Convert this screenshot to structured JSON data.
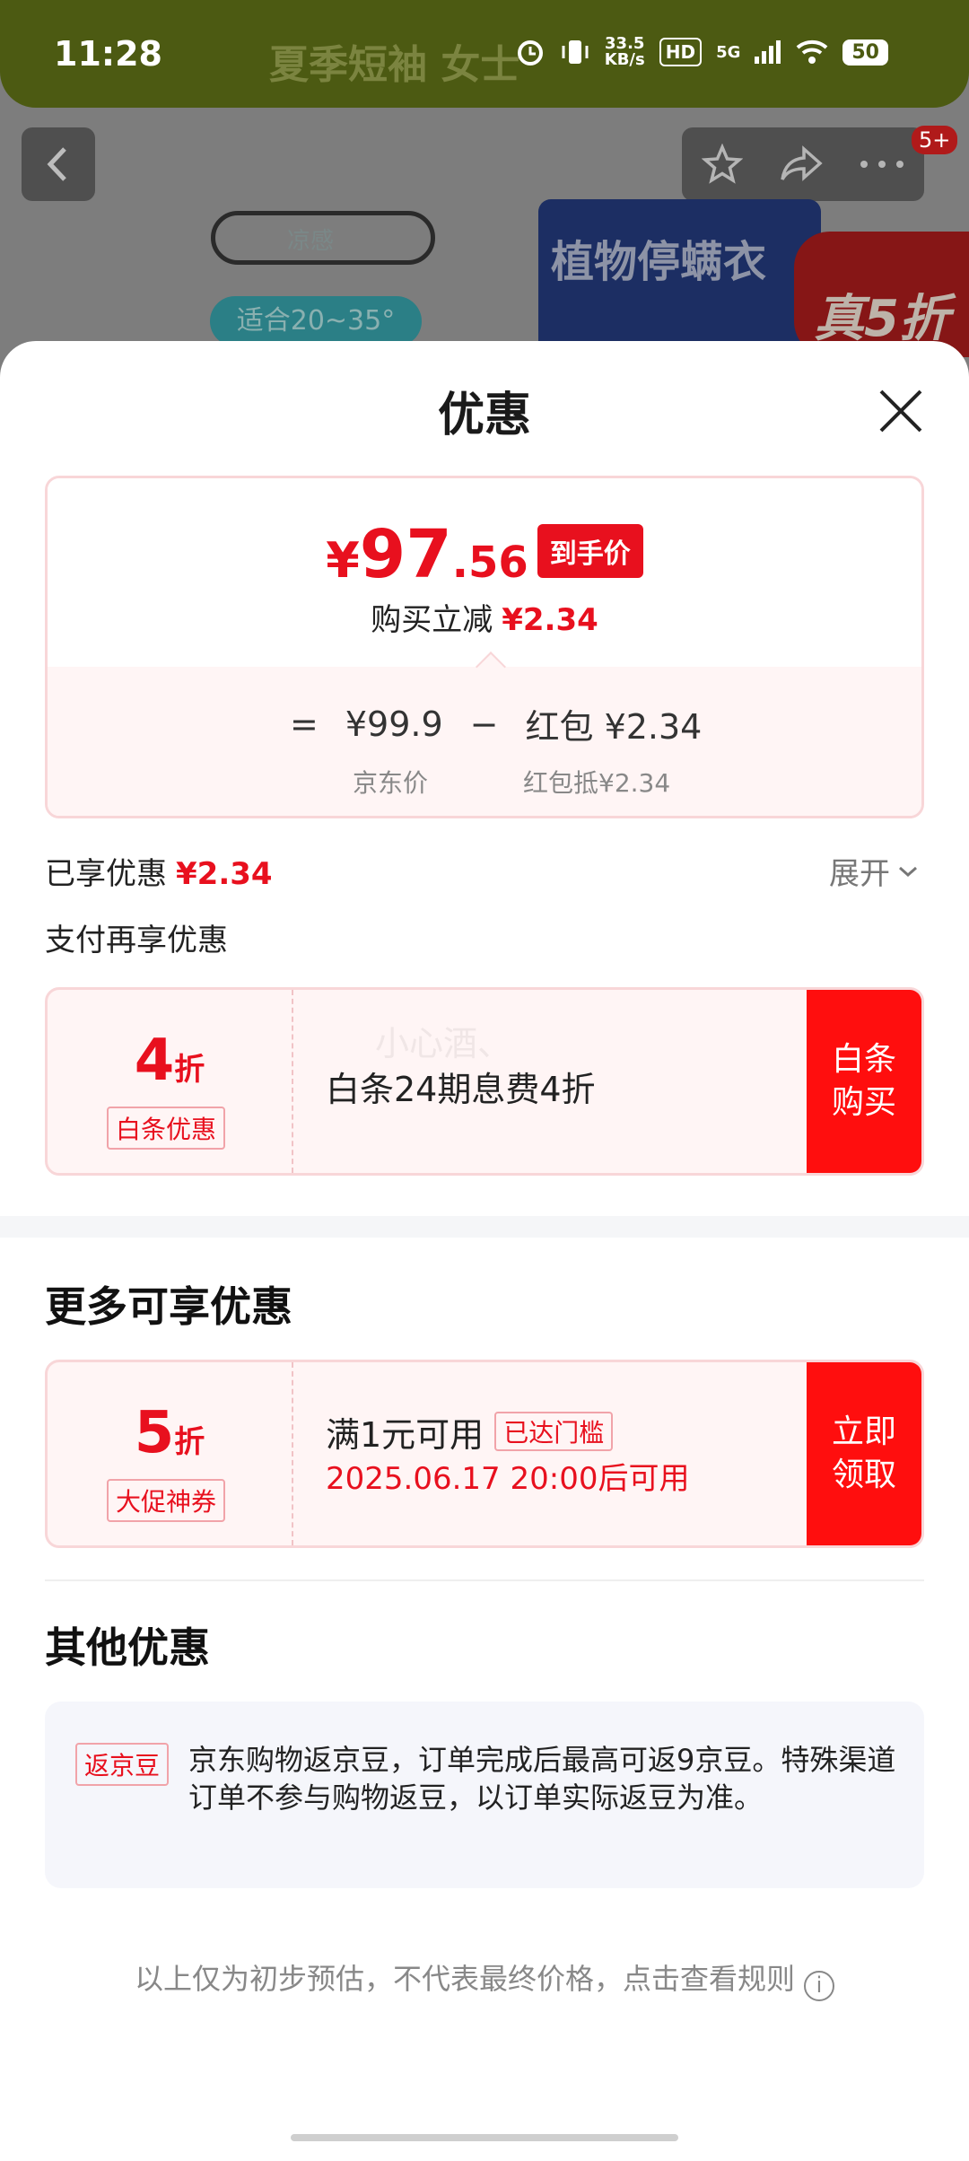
{
  "status_bar": {
    "time": "11:28",
    "net_speed": "33.5",
    "net_unit": "KB/s",
    "hd": "HD",
    "network": "5G",
    "battery": "50",
    "page_title_faded": "夏季短袖 女士"
  },
  "background": {
    "back_icon": "chevron-left-icon",
    "badge": "5+",
    "thermo_label": "凉感",
    "temp_range": "适合20~35°",
    "product_box_text": "植物停螨衣",
    "promo_tag": "真5折"
  },
  "sheet": {
    "title": "优惠",
    "price": {
      "yen": "¥",
      "integer": "97",
      "decimal": ".56",
      "final_tag": "到手价",
      "instant_save_label": "购买立减",
      "instant_save_value": "¥2.34"
    },
    "calc": {
      "equals": "=",
      "jd_price": "¥99.9",
      "minus": "−",
      "redpack": "红包 ¥2.34",
      "jd_price_label": "京东价",
      "redpack_label": "红包抵¥2.34"
    },
    "enjoyed_label": "已享优惠",
    "enjoyed_value": "¥2.34",
    "expand_label": "展开",
    "pay_more_title": "支付再享优惠",
    "baitiao": {
      "discount_num": "4",
      "discount_unit": "折",
      "tag": "白条优惠",
      "desc": "白条24期息费4折",
      "button": "白条购买",
      "watermark": "小心酒、"
    },
    "more_title": "更多可享优惠",
    "promo_coupon": {
      "discount_num": "5",
      "discount_unit": "折",
      "tag": "大促神券",
      "condition": "满1元可用",
      "reached": "已达门槛",
      "valid_time": "2025.06.17 20:00后可用",
      "button": "立即领取"
    },
    "other_title": "其他优惠",
    "other": {
      "tag": "返京豆",
      "text": "京东购物返京豆，订单完成后最高可返9京豆。特殊渠道订单不参与购物返豆，以订单实际返豆为准。"
    },
    "footnote": "以上仅为初步预估，不代表最终价格，点击查看规则",
    "colors": {
      "accent": "#e8101e",
      "button": "#ff0e0e",
      "card_border": "#f8d6d8"
    }
  }
}
